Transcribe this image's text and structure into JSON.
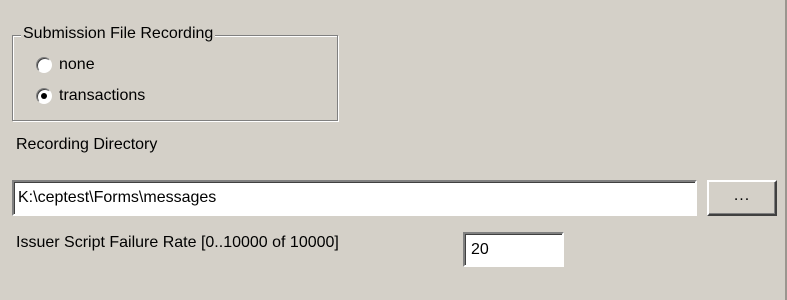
{
  "group": {
    "title": "Submission File Recording",
    "options": [
      {
        "label": "none",
        "selected": false
      },
      {
        "label": "transactions",
        "selected": true
      }
    ]
  },
  "recording_directory": {
    "label": "Recording Directory",
    "value": "K:\\ceptest\\Forms\\messages",
    "browse_label": "..."
  },
  "failure_rate": {
    "label": "Issuer Script Failure Rate [0..10000 of 10000]",
    "value": "20"
  }
}
